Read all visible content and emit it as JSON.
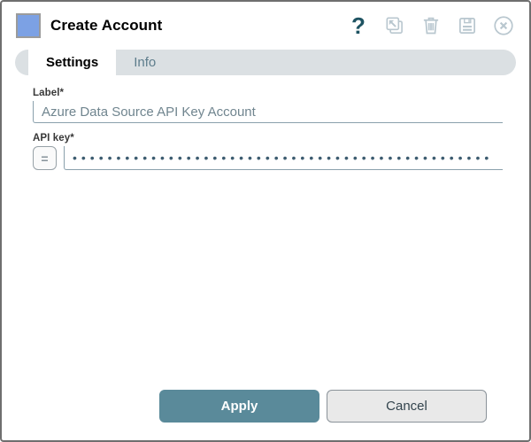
{
  "window": {
    "title": "Create Account",
    "help_icon_glyph": "?"
  },
  "tabs": {
    "settings": "Settings",
    "info": "Info"
  },
  "form": {
    "label_field": {
      "label": "Label*",
      "value": "Azure Data Source API Key Account"
    },
    "api_key_field": {
      "label": "API key*",
      "masked_value": "••••••••••••••••••••••••••••••••••••••••••••••••",
      "flow_variable_glyph": "="
    }
  },
  "footer": {
    "apply": "Apply",
    "cancel": "Cancel"
  },
  "colors": {
    "accent_teal": "#5a8a9a",
    "node_icon_blue": "#7ca1e4",
    "disabled_icon_gray": "#b9c7cf",
    "help_icon_teal": "#1e5362",
    "tab_bar_gray": "#dbe0e3",
    "input_border": "#8aa0ac",
    "input_text": "#70858f",
    "masked_dots": "#3d5c70"
  }
}
